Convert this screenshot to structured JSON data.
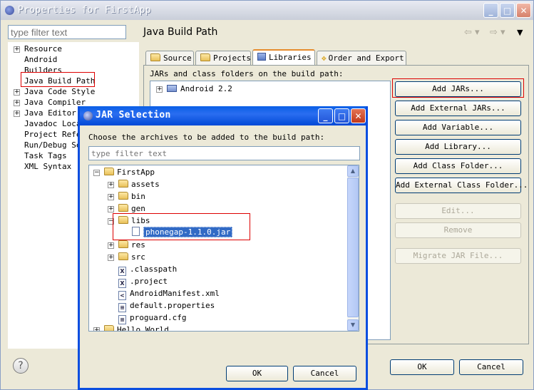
{
  "main_window": {
    "title": "Properties for FirstApp",
    "filter_placeholder": "type filter text",
    "tree": [
      "Resource",
      "Android",
      "Builders",
      "Java Build Path",
      "Java Code Style",
      "Java Compiler",
      "Java Editor",
      "Javadoc Loca",
      "Project Refe",
      "Run/Debug Se",
      "Task Tags",
      "XML Syntax"
    ],
    "page_title": "Java Build Path",
    "tabs": [
      "Source",
      "Projects",
      "Libraries",
      "Order and Export"
    ],
    "active_tab": "Libraries",
    "jars_label": "JARs and class folders on the build path:",
    "jar_list": [
      "Android 2.2"
    ],
    "buttons": [
      "Add JARs...",
      "Add External JARs...",
      "Add Variable...",
      "Add Library...",
      "Add Class Folder...",
      "Add External Class Folder...",
      "Edit...",
      "Remove",
      "Migrate JAR File..."
    ],
    "ok": "OK",
    "cancel": "Cancel",
    "help": "?"
  },
  "jar_dialog": {
    "title": "JAR Selection",
    "instruction": "Choose the archives to be added to the build path:",
    "filter_placeholder": "type filter text",
    "tree": [
      "FirstApp",
      "assets",
      "bin",
      "gen",
      "libs",
      "phonegap-1.1.0.jar",
      "res",
      "src",
      ".classpath",
      ".project",
      "AndroidManifest.xml",
      "default.properties",
      "proguard.cfg",
      "Hello World"
    ],
    "ok": "OK",
    "cancel": "Cancel"
  },
  "colors": {
    "xp_blue": "#0a4ee0",
    "selection": "#316ac5",
    "highlight_red": "#dd0000",
    "active_tab_accent": "#e68b2c"
  }
}
